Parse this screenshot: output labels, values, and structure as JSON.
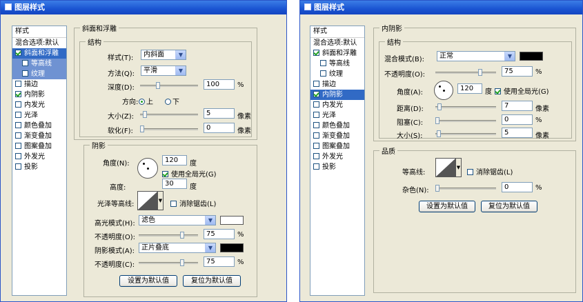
{
  "left": {
    "title": "图层样式",
    "sidebar": {
      "header": "样式",
      "items": [
        {
          "label": "混合选项:默认"
        },
        {
          "label": "斜面和浮雕"
        },
        {
          "label": "等高线"
        },
        {
          "label": "纹理"
        },
        {
          "label": "描边"
        },
        {
          "label": "内阴影"
        },
        {
          "label": "内发光"
        },
        {
          "label": "光泽"
        },
        {
          "label": "颜色叠加"
        },
        {
          "label": "渐变叠加"
        },
        {
          "label": "图案叠加"
        },
        {
          "label": "外发光"
        },
        {
          "label": "投影"
        }
      ]
    },
    "structure": {
      "legend": "斜面和浮雕",
      "sub": "结构",
      "style_label": "样式(T):",
      "style_value": "内斜面",
      "technique_label": "方法(Q):",
      "technique_value": "平滑",
      "depth_label": "深度(D):",
      "depth_value": "100",
      "percent": "%",
      "direction_label": "方向:",
      "up": "上",
      "down": "下",
      "size_label": "大小(Z):",
      "size_value": "5",
      "px": "像素",
      "soften_label": "软化(F):",
      "soften_value": "0",
      "depth_frac": 0.3,
      "size_frac": 0.05,
      "soften_frac": 0.0
    },
    "shading": {
      "legend": "阴影",
      "angle_label": "角度(N):",
      "angle_value": "120",
      "deg": "度",
      "global_light": "使用全局光(G)",
      "altitude_label": "高度:",
      "altitude_value": "30",
      "gloss_label": "光泽等高线:",
      "anti_alias": "消除锯齿(L)",
      "highlight_mode_label": "高光模式(H):",
      "highlight_mode_value": "滤色",
      "opacity1_label": "不透明度(O):",
      "opacity1_value": "75",
      "shadow_mode_label": "阴影模式(A):",
      "shadow_mode_value": "正片叠底",
      "opacity2_label": "不透明度(C):",
      "opacity2_value": "75",
      "opacity1_frac": 0.75,
      "opacity2_frac": 0.75,
      "highlight_color": "#ffffff",
      "shadow_color": "#000000"
    },
    "buttons": {
      "default": "设置为默认值",
      "reset": "复位为默认值"
    }
  },
  "right": {
    "title": "图层样式",
    "sidebar": {
      "header": "样式",
      "items": [
        {
          "label": "混合选项:默认"
        },
        {
          "label": "斜面和浮雕"
        },
        {
          "label": "等高线"
        },
        {
          "label": "纹理"
        },
        {
          "label": "描边"
        },
        {
          "label": "内阴影"
        },
        {
          "label": "内发光"
        },
        {
          "label": "光泽"
        },
        {
          "label": "颜色叠加"
        },
        {
          "label": "渐变叠加"
        },
        {
          "label": "图案叠加"
        },
        {
          "label": "外发光"
        },
        {
          "label": "投影"
        }
      ]
    },
    "inner_shadow": {
      "legend": "内阴影",
      "sub": "结构",
      "blend_label": "混合模式(B):",
      "blend_value": "正常",
      "opacity_label": "不透明度(O):",
      "opacity_value": "75",
      "percent": "%",
      "angle_label": "角度(A):",
      "angle_value": "120",
      "deg": "度",
      "global_light": "使用全局光(G)",
      "distance_label": "距离(D):",
      "distance_value": "7",
      "px": "像素",
      "choke_label": "阻塞(C):",
      "choke_value": "0",
      "size_label": "大小(S):",
      "size_value": "5",
      "opacity_frac": 0.75,
      "distance_frac": 0.04,
      "choke_frac": 0.0,
      "size_frac": 0.03,
      "color": "#000000"
    },
    "quality": {
      "legend": "品质",
      "contour_label": "等高线:",
      "anti_alias": "消除锯齿(L)",
      "noise_label": "杂色(N):",
      "noise_value": "0",
      "noise_frac": 0.0
    },
    "buttons": {
      "default": "设置为默认值",
      "reset": "复位为默认值"
    }
  }
}
